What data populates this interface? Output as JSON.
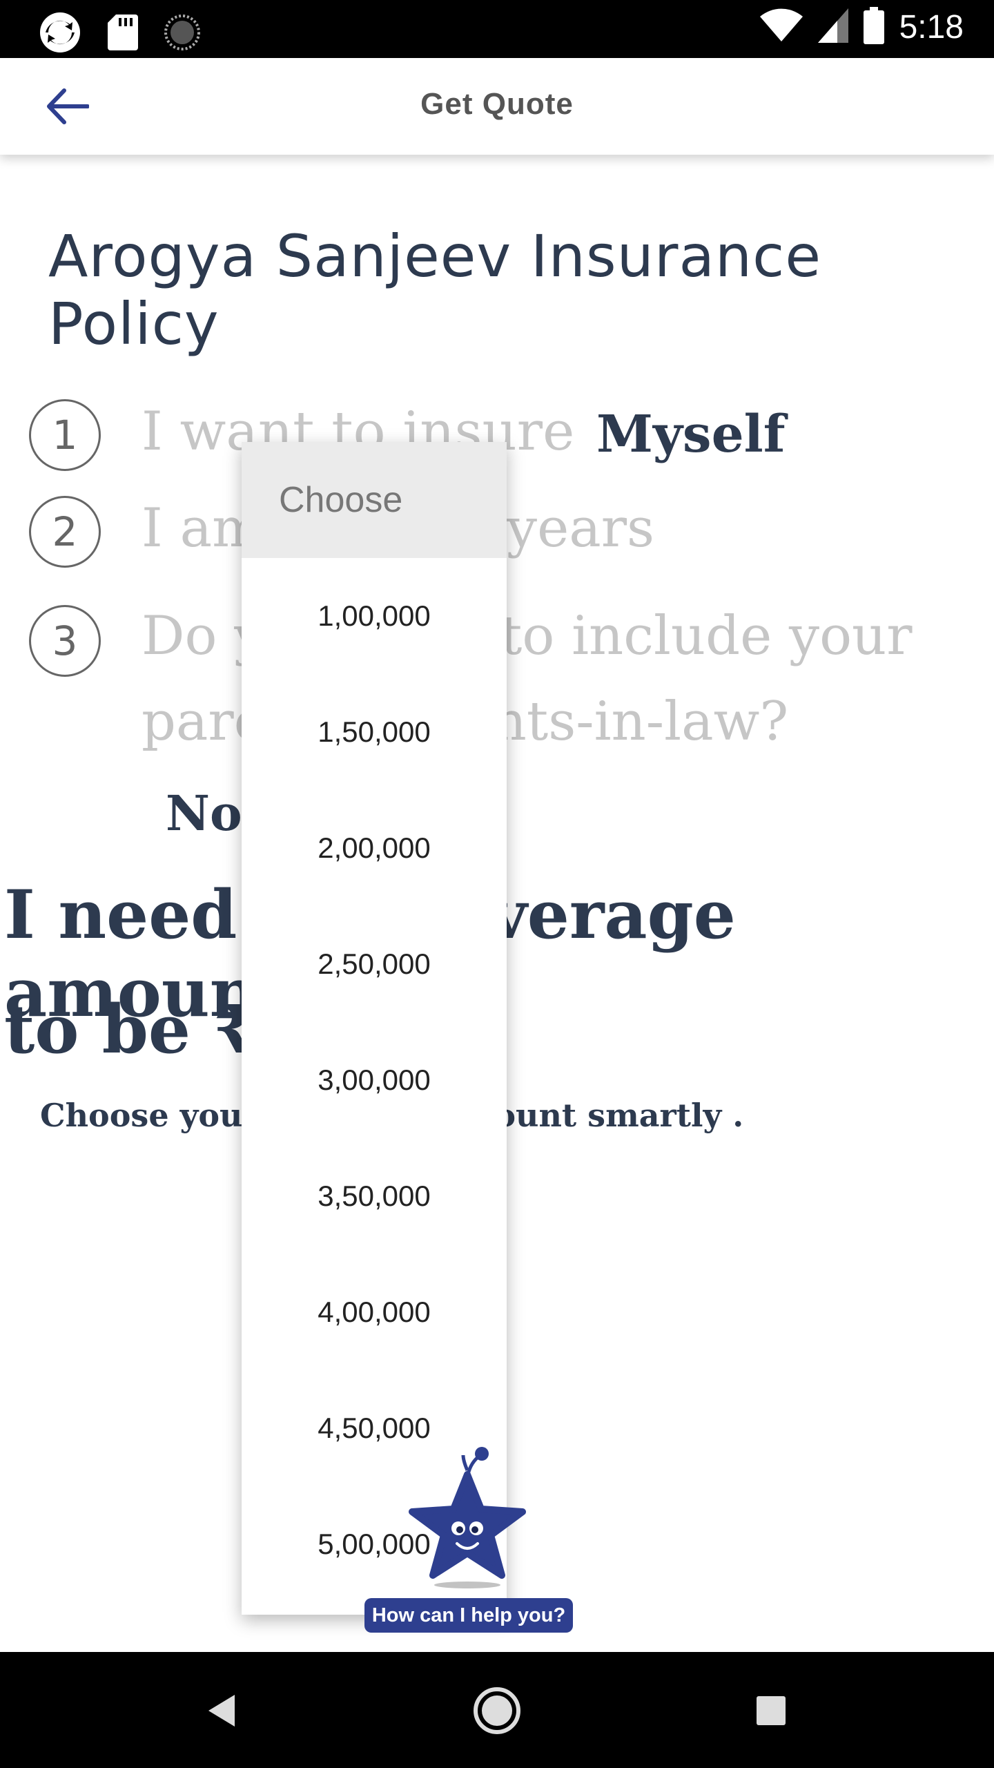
{
  "status_bar": {
    "time": "5:18",
    "left_icons": [
      "sync-app-icon",
      "sd-card-icon",
      "loading-icon"
    ],
    "right_icons": [
      "wifi-icon",
      "signal-icon",
      "battery-icon"
    ]
  },
  "app_bar": {
    "title": "Get Quote",
    "back_icon": "arrow-left-icon"
  },
  "policy": {
    "title": "Arogya Sanjeev Insurance Policy"
  },
  "steps": [
    {
      "number": "1",
      "text": "I want to insure",
      "answer": "Myself"
    },
    {
      "number": "2",
      "text": "I am",
      "text_end": "years"
    },
    {
      "number": "3",
      "text_line1": "Do you want to include your",
      "text_line2": "parents/parents-in-law?",
      "answer": "No"
    }
  ],
  "coverage": {
    "line1": "I need the coverage amount",
    "line2": "to be ₹",
    "hint": "Choose your coverage amount smartly ."
  },
  "dropdown": {
    "header": "Choose",
    "options": [
      "1,00,000",
      "1,50,000",
      "2,00,000",
      "2,50,000",
      "3,00,000",
      "3,50,000",
      "4,00,000",
      "4,50,000",
      "5,00,000"
    ]
  },
  "assistant": {
    "label": "How can I help you?",
    "icon": "star-mascot-icon"
  },
  "nav_bar": {
    "icons": [
      "back-triangle-icon",
      "home-circle-icon",
      "recents-square-icon"
    ]
  },
  "colors": {
    "primary": "#2e3f8f",
    "text_dark": "#2d3a4f",
    "faded": "#c6c6c6"
  }
}
